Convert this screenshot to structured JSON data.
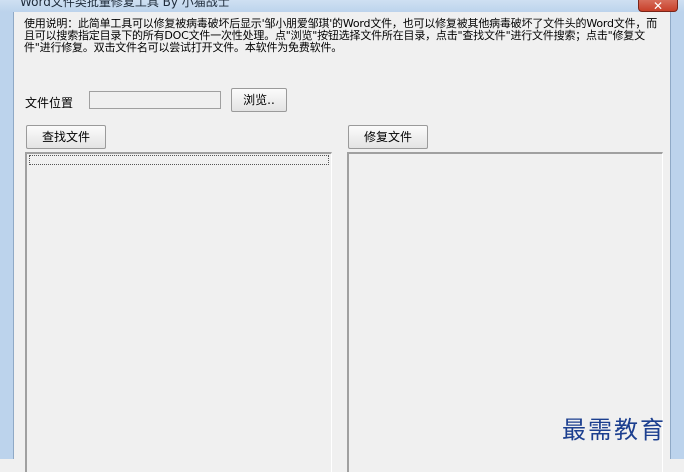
{
  "window": {
    "title": "Word文件类批量修复工具 By 小猫战士",
    "close_symbol": "✕"
  },
  "instructions": "使用说明：此简单工具可以修复被病毒破坏后显示'邹小朋爱邹琪'的Word文件，也可以修复被其他病毒破坏了文件头的Word文件，而且可以搜索指定目录下的所有DOC文件一次性处理。点\"浏览\"按钮选择文件所在目录，点击\"查找文件\"进行文件搜索；点击\"修复文件\"进行修复。双击文件名可以尝试打开文件。本软件为免费软件。",
  "file_location": {
    "label": "文件位置",
    "value": "",
    "browse_label": "浏览.."
  },
  "buttons": {
    "find_label": "查找文件",
    "repair_label": "修复文件"
  },
  "watermark": "最需教育"
}
